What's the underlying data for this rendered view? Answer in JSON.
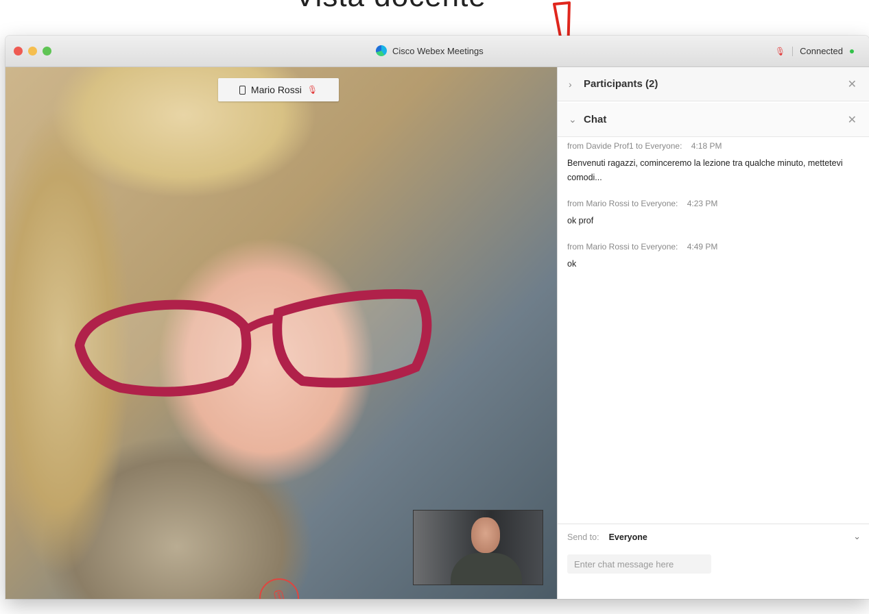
{
  "annotation": {
    "caption": "Vista docente"
  },
  "window": {
    "title": "Cisco Webex Meetings",
    "status": "Connected",
    "mic_status_icon": "mic-muted-icon"
  },
  "video": {
    "participant_name": "Mario Rossi",
    "mute_button_icon": "mic-muted-icon"
  },
  "panel": {
    "participants_title": "Participants (2)",
    "chat_title": "Chat",
    "messages": [
      {
        "from": "from Davide Prof1 to Everyone:",
        "time": "4:18 PM",
        "text": "Benvenuti ragazzi, cominceremo la lezione tra qualche minuto, mettetevi comodi..."
      },
      {
        "from": "from Mario Rossi to Everyone:",
        "time": "4:23 PM",
        "text": "ok prof"
      },
      {
        "from": "from Mario Rossi to Everyone:",
        "time": "4:49 PM",
        "text": "ok"
      }
    ],
    "send_to_label": "Send to:",
    "send_to_value": "Everyone",
    "input_placeholder": "Enter chat message here"
  },
  "colors": {
    "accent_red": "#e0453f",
    "status_green": "#33c24a"
  }
}
